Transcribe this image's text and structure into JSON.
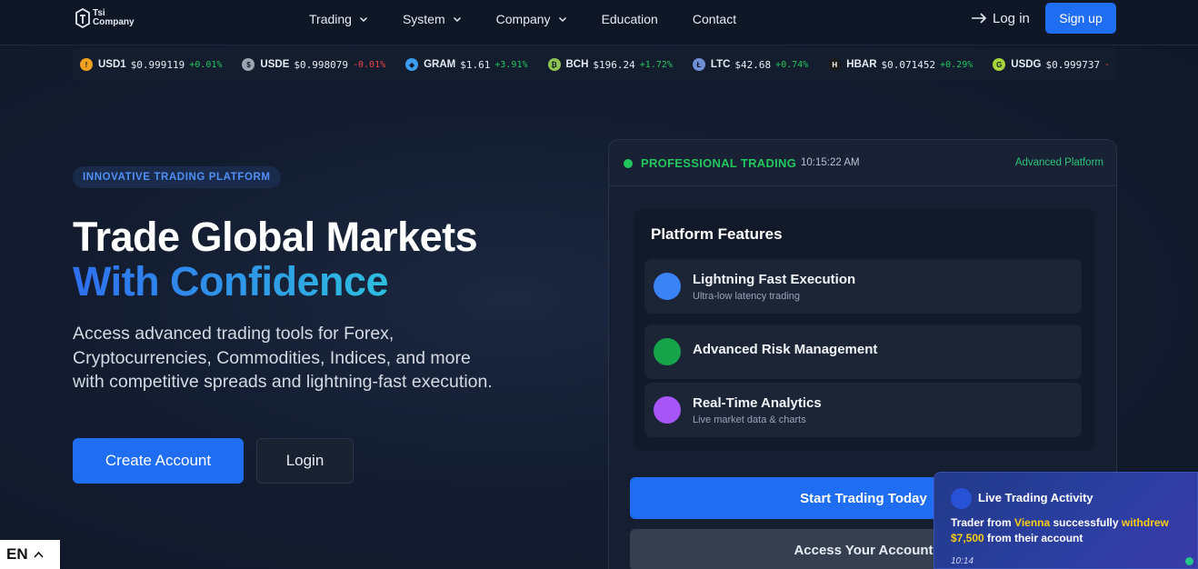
{
  "brand": {
    "line1": "Tsi",
    "line2": "Company"
  },
  "nav": {
    "items": [
      {
        "label": "Trading",
        "dropdown": true
      },
      {
        "label": "System",
        "dropdown": true
      },
      {
        "label": "Company",
        "dropdown": true
      },
      {
        "label": "Education",
        "dropdown": false
      },
      {
        "label": "Contact",
        "dropdown": false
      }
    ],
    "login": "Log in",
    "signup": "Sign up"
  },
  "ticker": [
    {
      "symbol": "USD1",
      "price": "$0.999119",
      "change": "+0.01%",
      "dir": "up",
      "color": "#f0a020",
      "glyph": "!"
    },
    {
      "symbol": "USDE",
      "price": "$0.998079",
      "change": "-0.01%",
      "dir": "down",
      "color": "#9aa3b0",
      "glyph": "$"
    },
    {
      "symbol": "GRAM",
      "price": "$1.61",
      "change": "+3.91%",
      "dir": "up",
      "color": "#3b9cf0",
      "glyph": "◆"
    },
    {
      "symbol": "BCH",
      "price": "$196.24",
      "change": "+1.72%",
      "dir": "up",
      "color": "#8dc351",
      "glyph": "₿"
    },
    {
      "symbol": "LTC",
      "price": "$42.68",
      "change": "+0.74%",
      "dir": "up",
      "color": "#6f8fd6",
      "glyph": "Ł"
    },
    {
      "symbol": "HBAR",
      "price": "$0.071452",
      "change": "+0.29%",
      "dir": "up",
      "color": "#1a1a1a",
      "glyph": "H"
    },
    {
      "symbol": "USDG",
      "price": "$0.999737",
      "change": "-",
      "dir": "down",
      "color": "#a6d33a",
      "glyph": "G"
    }
  ],
  "hero": {
    "badge": "INNOVATIVE TRADING PLATFORM",
    "title_line1": "Trade Global Markets",
    "title_line2": "With Confidence",
    "lead": "Access advanced trading tools for Forex, Cryptocurrencies, Commodities, Indices, and more with competitive spreads and lightning-fast execution.",
    "create_account": "Create Account",
    "login": "Login"
  },
  "panel": {
    "status": "PROFESSIONAL TRADING",
    "time": "10:15:22 AM",
    "advanced_link": "Advanced Platform",
    "features_title": "Platform Features",
    "features": [
      {
        "title": "Lightning Fast Execution",
        "subtitle": "Ultra-low latency trading",
        "color": "#3b82f6"
      },
      {
        "title": "Advanced Risk Management",
        "subtitle": "",
        "color": "#16a34a"
      },
      {
        "title": "Real-Time Analytics",
        "subtitle": "Live market data & charts",
        "color": "#a855f7"
      }
    ],
    "start_trading": "Start Trading Today",
    "access_account": "Access Your Account"
  },
  "toast": {
    "title": "Live Trading Activity",
    "prefix": "Trader from ",
    "city": "Vienna",
    "middle": " successfully ",
    "action": "withdrew",
    "amount": "$7,500",
    "suffix": " from their account",
    "time": "10:14"
  },
  "language": {
    "current": "EN"
  }
}
